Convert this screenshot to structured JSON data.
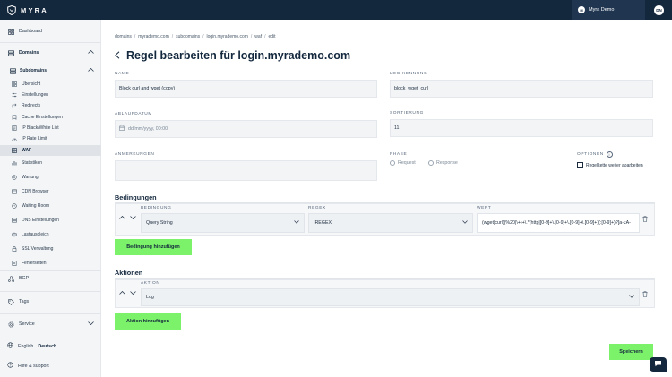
{
  "app": {
    "brand": "MYRA"
  },
  "user": {
    "name": "Myra Demo",
    "avatar": "M",
    "initials": "DN"
  },
  "sidebar": {
    "dashboard": "Dashboard",
    "domains": "Domains",
    "subdomains": "Subdomains",
    "subitems": [
      "Übersicht",
      "Einstellungen",
      "Redirects",
      "Cache Einstellungen",
      "IP Black/White List",
      "IP Rate Limit",
      "WAF"
    ],
    "items": [
      "Statistiken",
      "Wartung",
      "CDN Browser",
      "Waiting Room",
      "DNS Einstellungen",
      "Lastausgleich",
      "SSL Verwaltung",
      "Fehlerseiten"
    ],
    "bgp": "BGP",
    "tags": "Tags",
    "service": "Service",
    "lang_en": "English",
    "lang_de": "Deutsch",
    "help": "Hilfe & support"
  },
  "breadcrumb": [
    "domains",
    "myrademo.com",
    "subdomains",
    "login.myrademo.com",
    "waf",
    "edit"
  ],
  "page": {
    "title": "Regel bearbeiten für login.myrademo.com"
  },
  "form": {
    "name_label": "NAME",
    "name_value": "Block curl and wget (copy)",
    "log_label": "LOG-KENNUNG",
    "log_value": "block_wget_curl",
    "expiry_label": "ABLAUFDATUM",
    "expiry_placeholder": "dd/mm/yyyy, 00:00",
    "sort_label": "SORTIERUNG",
    "sort_value": "11",
    "notes_label": "ANMERKUNGEN",
    "phase_label": "PHASE",
    "phase_request": "Request",
    "phase_response": "Response",
    "options_label": "OPTIONEN",
    "options_check": "Regelkette weiter abarbeiten"
  },
  "conditions": {
    "title": "Bedingungen",
    "col_condition": "BEDINGUNG",
    "col_regex": "REGEX",
    "col_value": "WERT",
    "condition": "Query String",
    "regex": "IREGEX",
    "value": "(wget|curl)(%20|\\+)+\\.*(http|[0-9]+\\.[0-9]+\\.[0-9]+\\.[0-9]+)(:[0-9]+)?[a-zA-",
    "add": "Bedingung hinzufügen"
  },
  "actions": {
    "title": "Aktionen",
    "col_action": "AKTION",
    "action": "Log",
    "add": "Aktion hinzufügen"
  },
  "save": "Speichern",
  "colors": {
    "navy": "#13273d",
    "accent_green": "#7cf26a",
    "sidebar_bg": "#f3f5f7"
  }
}
